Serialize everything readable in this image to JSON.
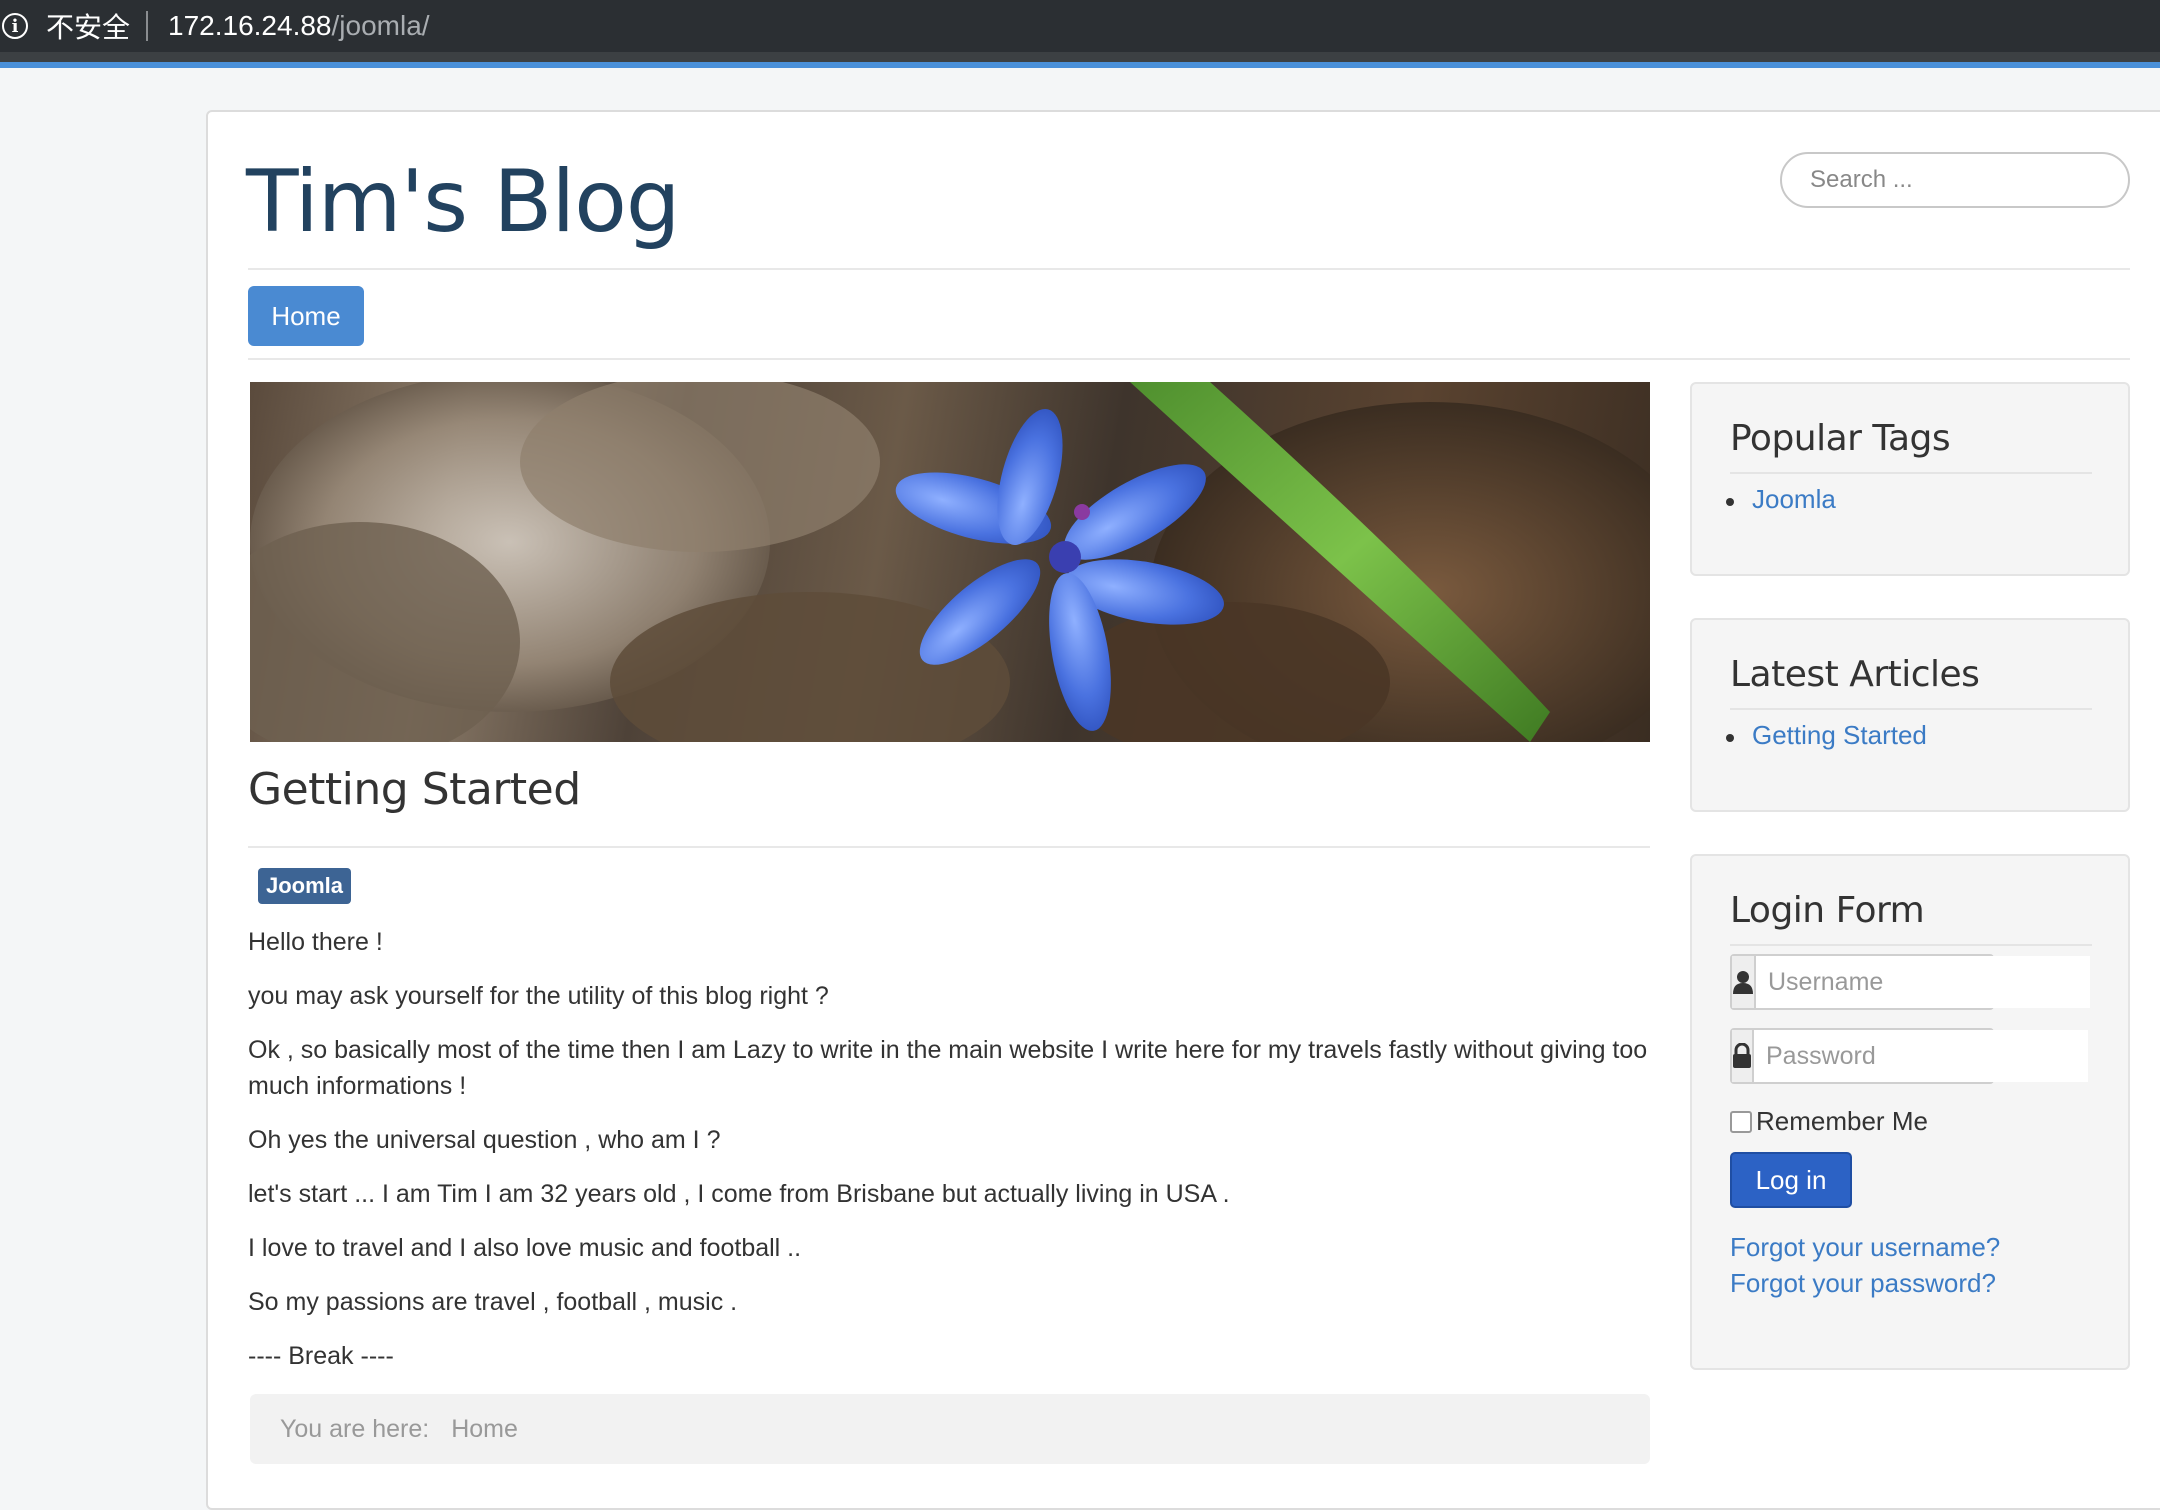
{
  "browser": {
    "security_label": "不安全",
    "url_host": "172.16.24.88",
    "url_path": "/joomla/"
  },
  "header": {
    "site_title": "Tim's Blog",
    "search_placeholder": "Search ..."
  },
  "nav": {
    "items": [
      {
        "label": "Home",
        "active": true
      }
    ]
  },
  "article": {
    "title": "Getting Started",
    "tags": [
      "Joomla"
    ],
    "paragraphs": [
      "Hello there  !",
      "you may ask yourself for the utility of this blog right ?",
      "Ok , so basically most of  the time then I am Lazy to write in the main website I write here for my travels fastly without giving too much informations !",
      "Oh yes the universal question , who am I ?",
      "let's start ... I am Tim I am 32 years old ,  I come from Brisbane but actually living in USA .",
      "I love to travel and I also love music and football ..",
      "So my passions are travel , football , music .",
      "---- Break ----"
    ]
  },
  "breadcrumb": {
    "prefix": "You are here:",
    "current": "Home"
  },
  "sidebar": {
    "popular_tags": {
      "title": "Popular Tags",
      "items": [
        "Joomla"
      ]
    },
    "latest_articles": {
      "title": "Latest Articles",
      "items": [
        "Getting Started"
      ]
    },
    "login_form": {
      "title": "Login Form",
      "username_placeholder": "Username",
      "password_placeholder": "Password",
      "remember_label": "Remember Me",
      "login_button": "Log in",
      "forgot_username": "Forgot your username?",
      "forgot_password": "Forgot your password?"
    }
  },
  "colors": {
    "title": "#22425f",
    "primary_button": "#4a8ad2",
    "login_button": "#2c62c5",
    "link": "#3b7bc5",
    "tag_badge": "#3d6494"
  }
}
